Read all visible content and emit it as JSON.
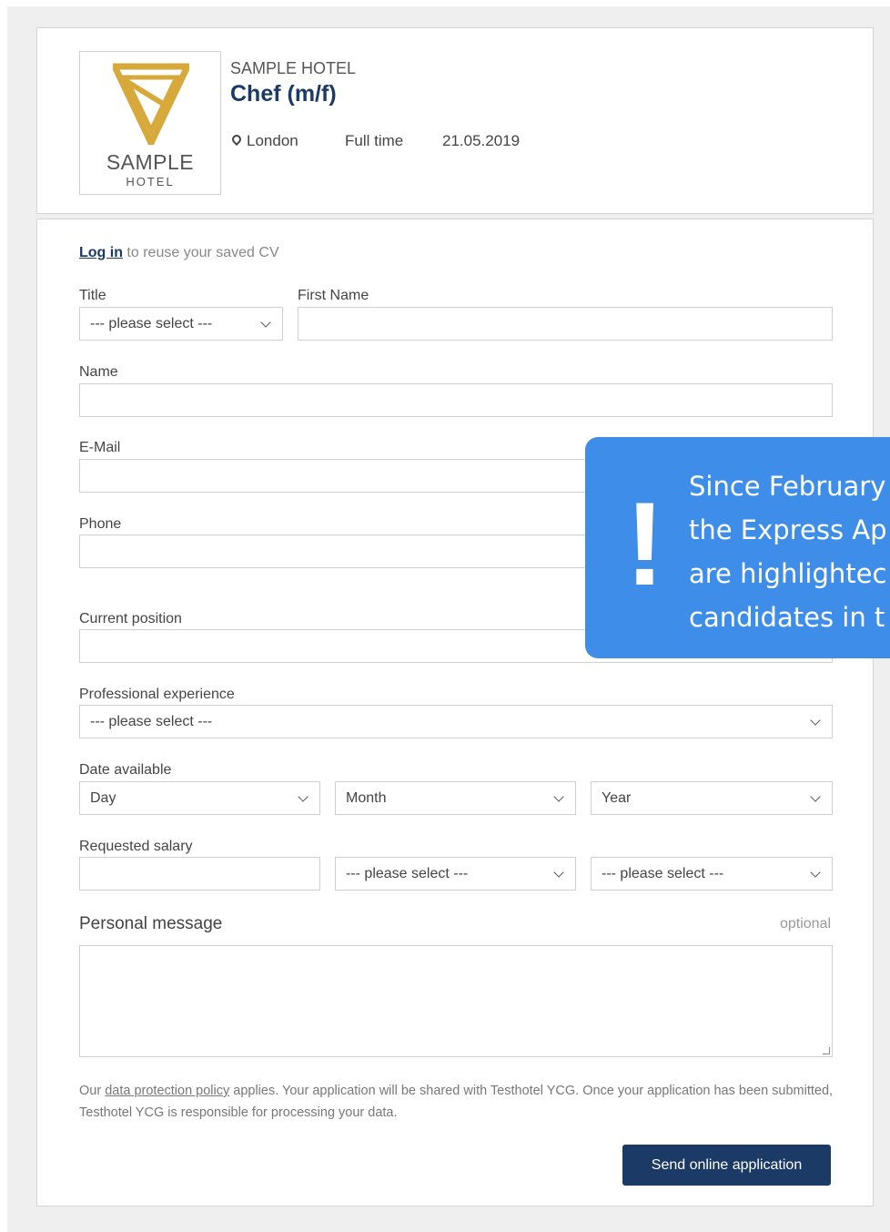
{
  "header": {
    "logo_name": "SAMPLE",
    "logo_sub": "HOTEL",
    "company": "SAMPLE HOTEL",
    "job_title": "Chef (m/f)",
    "location": "London",
    "employment_type": "Full time",
    "date": "21.05.2019"
  },
  "login": {
    "link_text": "Log in",
    "rest_text": " to reuse your saved CV"
  },
  "form": {
    "title_label": "Title",
    "title_value": "--- please select ---",
    "first_name_label": "First Name",
    "first_name_value": "",
    "name_label": "Name",
    "name_value": "",
    "email_label": "E-Mail",
    "email_value": "",
    "phone_label": "Phone",
    "phone_value": "",
    "current_position_label": "Current position",
    "current_position_value": "",
    "experience_label": "Professional experience",
    "experience_value": "--- please select ---",
    "date_available_label": "Date available",
    "day_value": "Day",
    "month_value": "Month",
    "year_value": "Year",
    "salary_label": "Requested salary",
    "salary_value": "",
    "salary_period_value": "--- please select ---",
    "salary_currency_value": "--- please select ---",
    "personal_message_label": "Personal message",
    "optional_label": "optional",
    "personal_message_value": ""
  },
  "privacy": {
    "prefix": "Our ",
    "link": "data protection policy",
    "suffix": " applies. Your application will be shared with Testhotel YCG. Once your application has been submitted, Testhotel YCG is responsible for processing your data."
  },
  "submit_label": "Send online application",
  "callout": {
    "symbol": "!",
    "line1": "Since February",
    "line2": "the Express Ap",
    "line3": "are highlightec",
    "line4": "candidates in t"
  },
  "colors": {
    "brand_navy": "#1b3a66",
    "logo_gold": "#d6a93a",
    "callout_blue": "#3e8ee9"
  }
}
